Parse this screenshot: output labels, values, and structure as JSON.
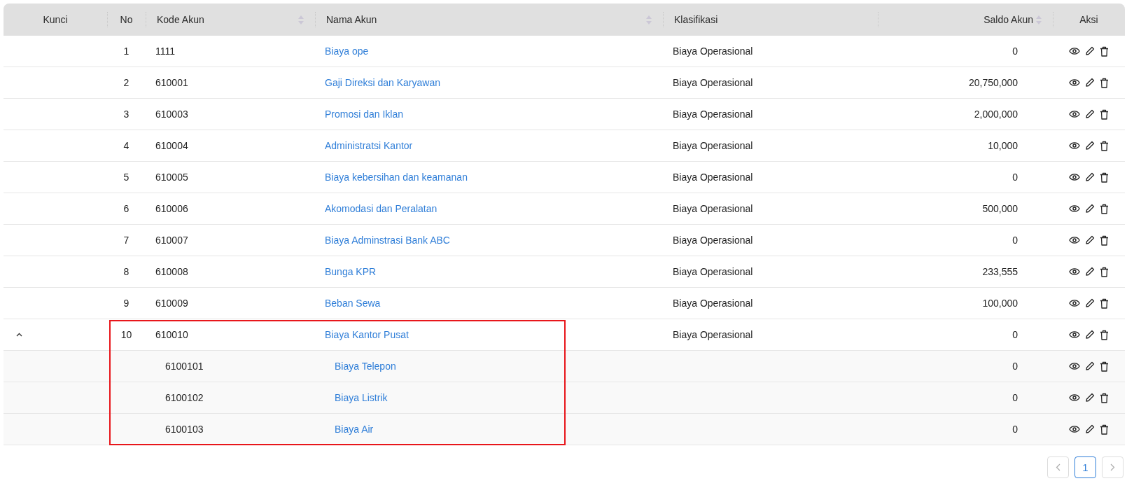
{
  "table": {
    "columns": [
      {
        "label": "Kunci",
        "sortable": false
      },
      {
        "label": "No",
        "sortable": false
      },
      {
        "label": "Kode Akun",
        "sortable": true
      },
      {
        "label": "Nama Akun",
        "sortable": true
      },
      {
        "label": "Klasifikasi",
        "sortable": false
      },
      {
        "label": "Saldo Akun",
        "sortable": true
      },
      {
        "label": "Aksi",
        "sortable": false
      }
    ],
    "rows": [
      {
        "no": "1",
        "code": "1111",
        "name": "Biaya ope",
        "classification": "Biaya Operasional",
        "balance": "0"
      },
      {
        "no": "2",
        "code": "610001",
        "name": "Gaji Direksi dan Karyawan",
        "classification": "Biaya Operasional",
        "balance": "20,750,000"
      },
      {
        "no": "3",
        "code": "610003",
        "name": "Promosi dan Iklan",
        "classification": "Biaya Operasional",
        "balance": "2,000,000"
      },
      {
        "no": "4",
        "code": "610004",
        "name": "Administratsi Kantor",
        "classification": "Biaya Operasional",
        "balance": "10,000"
      },
      {
        "no": "5",
        "code": "610005",
        "name": "Biaya kebersihan dan keamanan",
        "classification": "Biaya Operasional",
        "balance": "0"
      },
      {
        "no": "6",
        "code": "610006",
        "name": "Akomodasi dan Peralatan",
        "classification": "Biaya Operasional",
        "balance": "500,000"
      },
      {
        "no": "7",
        "code": "610007",
        "name": "Biaya Adminstrasi Bank ABC",
        "classification": "Biaya Operasional",
        "balance": "0"
      },
      {
        "no": "8",
        "code": "610008",
        "name": "Bunga KPR",
        "classification": "Biaya Operasional",
        "balance": "233,555"
      },
      {
        "no": "9",
        "code": "610009",
        "name": "Beban Sewa",
        "classification": "Biaya Operasional",
        "balance": "100,000"
      },
      {
        "no": "10",
        "code": "610010",
        "name": "Biaya Kantor Pusat",
        "classification": "Biaya Operasional",
        "balance": "0",
        "expanded": true,
        "highlighted": true,
        "children": [
          {
            "code": "6100101",
            "name": "Biaya Telepon",
            "balance": "0"
          },
          {
            "code": "6100102",
            "name": "Biaya Listrik",
            "balance": "0"
          },
          {
            "code": "6100103",
            "name": "Biaya Air",
            "balance": "0"
          }
        ]
      }
    ]
  },
  "pagination": {
    "pages": [
      {
        "label": "1",
        "selected": true
      }
    ]
  }
}
